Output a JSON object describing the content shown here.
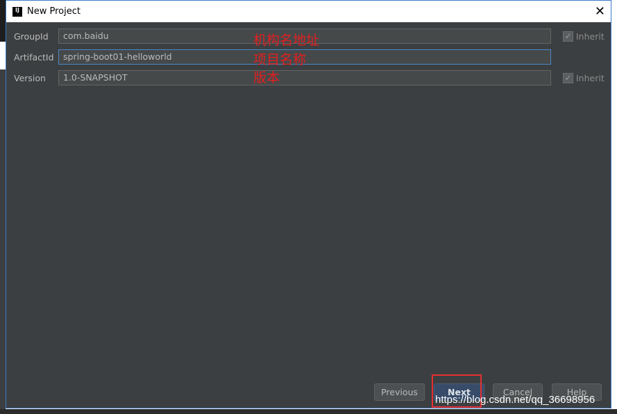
{
  "window": {
    "title": "New Project",
    "logo": "IJ"
  },
  "form": {
    "group_id": {
      "label": "GroupId",
      "value": "com.baidu",
      "inherit_label": "Inherit",
      "inherit_checked": true
    },
    "artifact_id": {
      "label": "ArtifactId",
      "value": "spring-boot01-helloworld"
    },
    "version": {
      "label": "Version",
      "value": "1.0-SNAPSHOT",
      "inherit_label": "Inherit",
      "inherit_checked": true
    }
  },
  "annotations": {
    "group": "机构名地址",
    "artifact": "项目名称",
    "version": "版本"
  },
  "buttons": {
    "previous": "Previous",
    "next": "Next",
    "cancel": "Cancel",
    "help": "Help"
  },
  "watermark": "https://blog.csdn.net/qq_36698956"
}
